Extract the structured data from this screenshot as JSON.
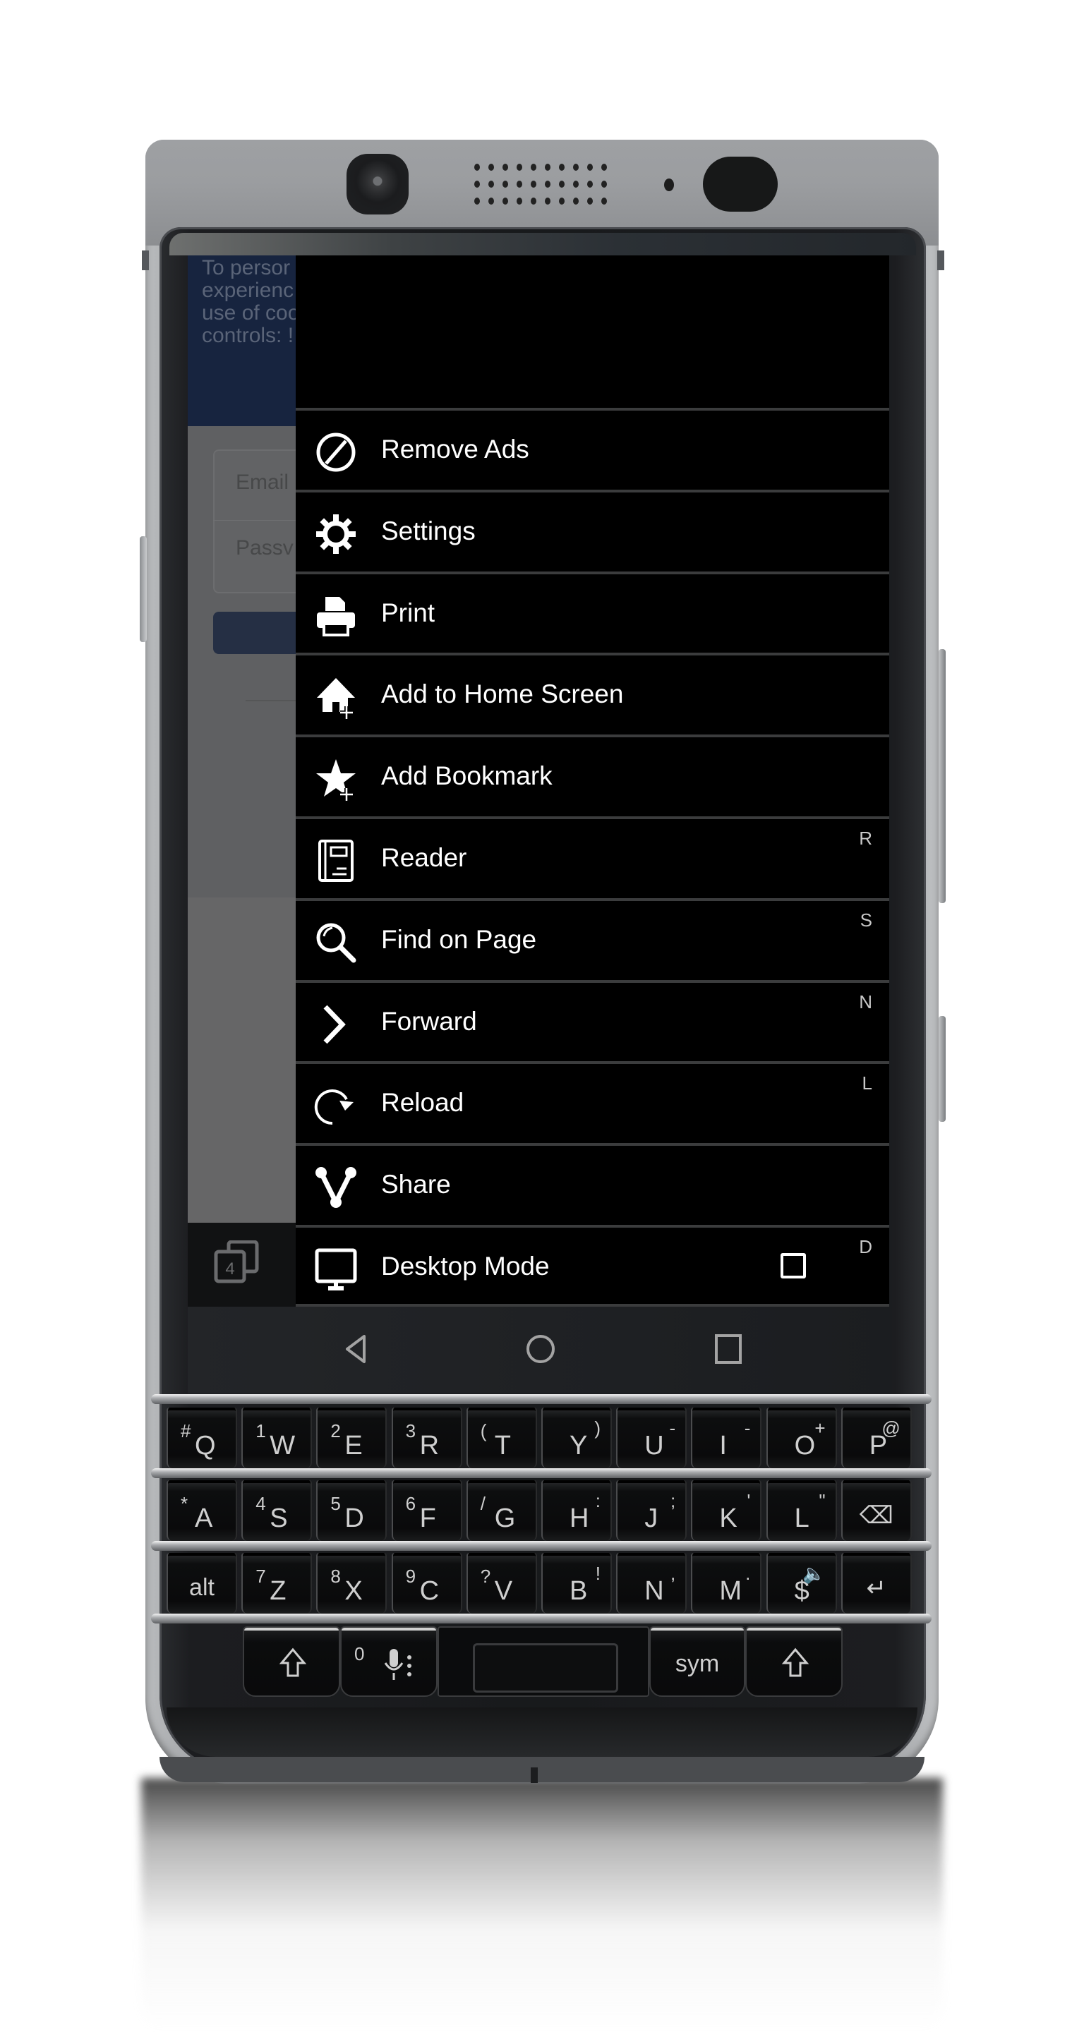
{
  "device": {
    "name": "BlackBerry KEYone style phone",
    "colors": {
      "menu_background": "#000000",
      "menu_divider": "#3b3c3d",
      "menu_text": "#ffffff",
      "shortcut_text": "#c8c8c8",
      "cookie_banner": "#17243f",
      "nav_icons": "#a0a0a0"
    }
  },
  "web_page": {
    "cookie_banner_text": "To persor\nexperienc\nuse of coo\ncontrols: !",
    "email_placeholder": "Email",
    "password_placeholder": "Passv",
    "tab_count": "4"
  },
  "menu": {
    "items": [
      {
        "label": "Remove Ads",
        "icon": "block-icon",
        "shortcut": ""
      },
      {
        "label": "Settings",
        "icon": "gear-icon",
        "shortcut": ""
      },
      {
        "label": "Print",
        "icon": "printer-icon",
        "shortcut": ""
      },
      {
        "label": "Add to Home Screen",
        "icon": "home-add-icon",
        "shortcut": ""
      },
      {
        "label": "Add Bookmark",
        "icon": "star-add-icon",
        "shortcut": ""
      },
      {
        "label": "Reader",
        "icon": "reader-icon",
        "shortcut": "R"
      },
      {
        "label": "Find on Page",
        "icon": "search-icon",
        "shortcut": "S"
      },
      {
        "label": "Forward",
        "icon": "chevron-right-icon",
        "shortcut": "N"
      },
      {
        "label": "Reload",
        "icon": "reload-icon",
        "shortcut": "L"
      },
      {
        "label": "Share",
        "icon": "share-icon",
        "shortcut": ""
      },
      {
        "label": "Desktop Mode",
        "icon": "monitor-icon",
        "shortcut": "D",
        "checkbox": false
      }
    ]
  },
  "nav": {
    "back": "back-icon",
    "home": "home-icon",
    "recents": "recents-icon"
  },
  "keyboard": {
    "row1": [
      {
        "main": "Q",
        "alt": "#",
        "alt_pos": "left"
      },
      {
        "main": "W",
        "alt": "1",
        "alt_pos": "left"
      },
      {
        "main": "E",
        "alt": "2",
        "alt_pos": "left"
      },
      {
        "main": "R",
        "alt": "3",
        "alt_pos": "left"
      },
      {
        "main": "T",
        "alt": "(",
        "alt_pos": "left"
      },
      {
        "main": "Y",
        "alt": ")",
        "alt_pos": "right"
      },
      {
        "main": "U",
        "alt": "-",
        "alt_pos": "right"
      },
      {
        "main": "I",
        "alt": "-",
        "alt_pos": "right"
      },
      {
        "main": "O",
        "alt": "+",
        "alt_pos": "right"
      },
      {
        "main": "P",
        "alt": "@",
        "alt_pos": "right"
      }
    ],
    "row2": [
      {
        "main": "A",
        "alt": "*",
        "alt_pos": "left"
      },
      {
        "main": "S",
        "alt": "4",
        "alt_pos": "left"
      },
      {
        "main": "D",
        "alt": "5",
        "alt_pos": "left"
      },
      {
        "main": "F",
        "alt": "6",
        "alt_pos": "left"
      },
      {
        "main": "G",
        "alt": "/",
        "alt_pos": "left"
      },
      {
        "main": "H",
        "alt": ":",
        "alt_pos": "right"
      },
      {
        "main": "J",
        "alt": ";",
        "alt_pos": "right"
      },
      {
        "main": "K",
        "alt": "'",
        "alt_pos": "right"
      },
      {
        "main": "L",
        "alt": "\"",
        "alt_pos": "right"
      },
      {
        "main": "⌫",
        "alt": "",
        "alt_pos": "right",
        "word": true
      }
    ],
    "row3": [
      {
        "main": "alt",
        "alt": "",
        "alt_pos": "left",
        "word": true
      },
      {
        "main": "Z",
        "alt": "7",
        "alt_pos": "left"
      },
      {
        "main": "X",
        "alt": "8",
        "alt_pos": "left"
      },
      {
        "main": "C",
        "alt": "9",
        "alt_pos": "left"
      },
      {
        "main": "V",
        "alt": "?",
        "alt_pos": "left"
      },
      {
        "main": "B",
        "alt": "!",
        "alt_pos": "right"
      },
      {
        "main": "N",
        "alt": ",",
        "alt_pos": "right"
      },
      {
        "main": "M",
        "alt": ".",
        "alt_pos": "right"
      },
      {
        "main": "$",
        "alt": "🔈",
        "alt_pos": "right"
      },
      {
        "main": "↵",
        "alt": "",
        "alt_pos": "right",
        "word": true
      }
    ],
    "bottom": {
      "left_shift": "⇧",
      "mic_key_alt": "0",
      "mic_key": "🎤",
      "sym": "sym",
      "right_shift": "⇧"
    }
  }
}
